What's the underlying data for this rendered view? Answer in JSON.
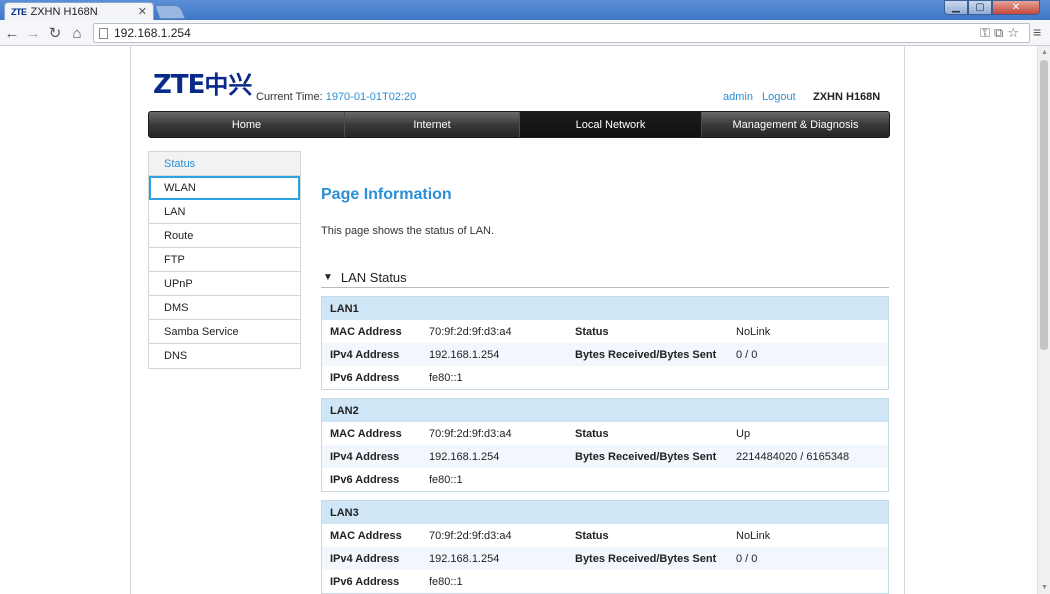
{
  "browser": {
    "tab_favicon": "ZTE",
    "tab_title": "ZXHN H168N",
    "tab_close": "✕",
    "url": "192.168.1.254"
  },
  "header": {
    "logo_latin": "ZTE",
    "logo_cn": "中兴",
    "current_time_label": "Current Time:",
    "current_time_value": "1970-01-01T02:20",
    "user": "admin",
    "logout": "Logout",
    "model": "ZXHN H168N"
  },
  "nav": [
    {
      "label": "Home"
    },
    {
      "label": "Internet"
    },
    {
      "label": "Local Network"
    },
    {
      "label": "Management & Diagnosis"
    }
  ],
  "sidebar": [
    {
      "label": "Status"
    },
    {
      "label": "WLAN"
    },
    {
      "label": "LAN"
    },
    {
      "label": "Route"
    },
    {
      "label": "FTP"
    },
    {
      "label": "UPnP"
    },
    {
      "label": "DMS"
    },
    {
      "label": "Samba Service"
    },
    {
      "label": "DNS"
    }
  ],
  "content": {
    "title": "Page Information",
    "description": "This page shows the status of LAN.",
    "section_title": "LAN Status",
    "labels": {
      "mac": "MAC Address",
      "ipv4": "IPv4 Address",
      "ipv6": "IPv6 Address",
      "status": "Status",
      "bytes": "Bytes Received/Bytes Sent"
    },
    "lans": [
      {
        "name": "LAN1",
        "mac": "70:9f:2d:9f:d3:a4",
        "status": "NoLink",
        "ipv4": "192.168.1.254",
        "bytes": "0 / 0",
        "ipv6": "fe80::1"
      },
      {
        "name": "LAN2",
        "mac": "70:9f:2d:9f:d3:a4",
        "status": "Up",
        "ipv4": "192.168.1.254",
        "bytes": "2214484020 / 6165348",
        "ipv6": "fe80::1"
      },
      {
        "name": "LAN3",
        "mac": "70:9f:2d:9f:d3:a4",
        "status": "NoLink",
        "ipv4": "192.168.1.254",
        "bytes": "0 / 0",
        "ipv6": "fe80::1"
      }
    ]
  },
  "colors": {
    "accent": "#2a8fd6",
    "lan_header": "#cfe6f7",
    "logo": "#0a2a8a"
  }
}
